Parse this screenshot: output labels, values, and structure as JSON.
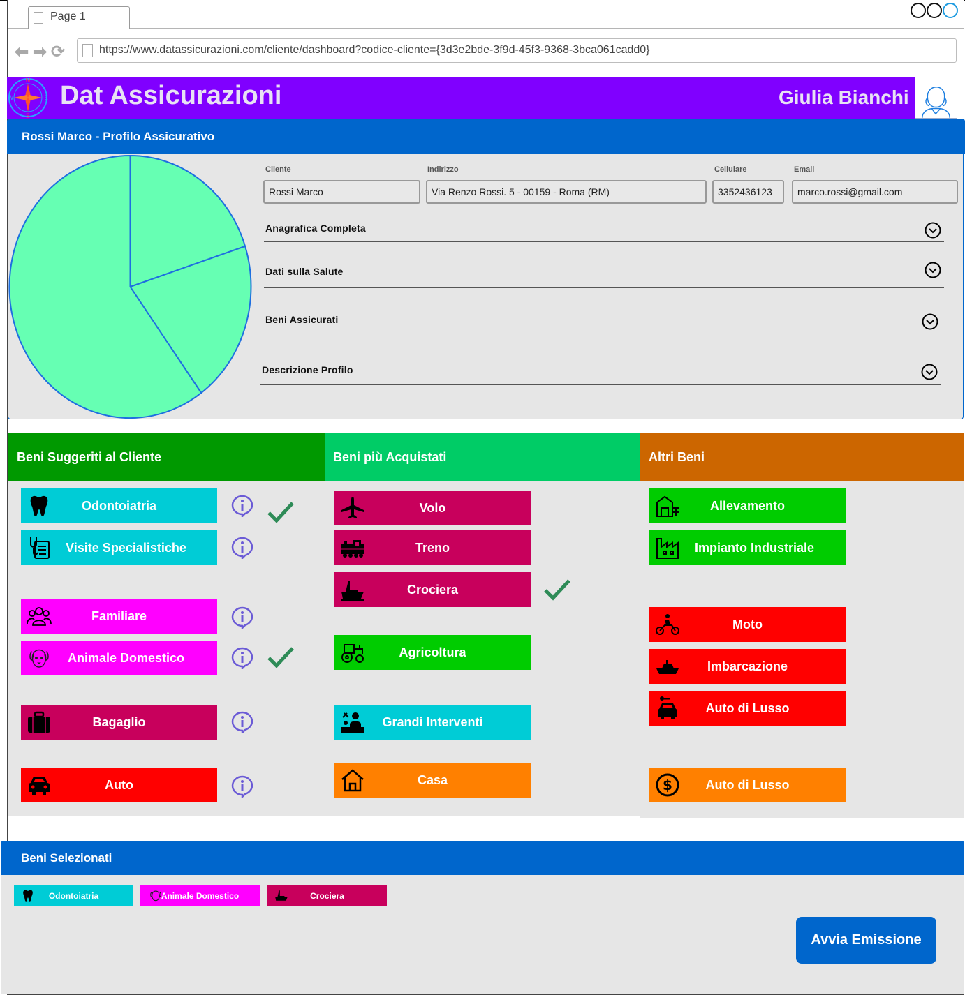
{
  "browser": {
    "tab_label": "Page 1",
    "url": "https://www.datassicurazioni.com/cliente/dashboard?codice-cliente={3d3e2bde-3f9d-45f3-9368-3bca061cadd0}"
  },
  "header": {
    "brand": "Dat Assicurazioni",
    "user_name": "Giulia Bianchi"
  },
  "profile": {
    "title": "Rossi Marco - Profilo Assicurativo",
    "fields": {
      "cliente": {
        "label": "Cliente",
        "value": "Rossi Marco"
      },
      "indirizzo": {
        "label": "Indirizzo",
        "value": "Via Renzo Rossi. 5 - 00159 - Roma (RM)"
      },
      "cellulare": {
        "label": "Cellulare",
        "value": "3352436123"
      },
      "email": {
        "label": "Email",
        "value": "marco.rossi@gmail.com"
      }
    },
    "accordions": [
      {
        "label": "Anagrafica Completa"
      },
      {
        "label": "Dati sulla Salute"
      },
      {
        "label": "Beni Assicurati"
      },
      {
        "label": "Descrizione Profilo"
      }
    ],
    "pie_colors": {
      "fill": "#66ffb3",
      "stroke": "#1e6fe0"
    }
  },
  "chart_data": {
    "type": "pie",
    "values": [
      20,
      20,
      60
    ],
    "labels": [],
    "title": ""
  },
  "columns": {
    "suggested": {
      "title": "Beni Suggeriti al Cliente",
      "color": "#009900",
      "items": [
        {
          "label": "Odontoiatria",
          "icon": "tooth-icon",
          "color": "#00ccd6",
          "selected": true
        },
        {
          "label": "Visite Specialistiche",
          "icon": "medical-record-icon",
          "color": "#00ccd6",
          "selected": false
        },
        {
          "label": "Familiare",
          "icon": "family-icon",
          "color": "#ff00ff",
          "selected": false
        },
        {
          "label": "Animale Domestico",
          "icon": "dog-icon",
          "color": "#ff00ff",
          "selected": true
        },
        {
          "label": "Bagaglio",
          "icon": "luggage-icon",
          "color": "#c8005c",
          "selected": false
        },
        {
          "label": "Auto",
          "icon": "car-icon",
          "color": "#ff0000",
          "selected": false
        }
      ]
    },
    "popular": {
      "title": "Beni più Acquistati",
      "color": "#00cc66",
      "items": [
        {
          "label": "Volo",
          "icon": "airplane-icon",
          "color": "#c8005c",
          "selected": false
        },
        {
          "label": "Treno",
          "icon": "train-icon",
          "color": "#c8005c",
          "selected": false
        },
        {
          "label": "Crociera",
          "icon": "ship-icon",
          "color": "#c8005c",
          "selected": true
        },
        {
          "label": "Agricoltura",
          "icon": "tractor-icon",
          "color": "#00cc00",
          "selected": false
        },
        {
          "label": "Grandi Interventi",
          "icon": "surgery-icon",
          "color": "#00ccd6",
          "selected": false
        },
        {
          "label": "Casa",
          "icon": "house-icon",
          "color": "#ff8000",
          "selected": false
        }
      ]
    },
    "other": {
      "title": "Altri Beni",
      "color": "#cc6600",
      "items": [
        {
          "label": "Allevamento",
          "icon": "barn-icon",
          "color": "#00cc00"
        },
        {
          "label": "Impianto Industriale",
          "icon": "factory-icon",
          "color": "#00cc00"
        },
        {
          "label": "Moto",
          "icon": "motorbike-icon",
          "color": "#ff0000"
        },
        {
          "label": "Imbarcazione",
          "icon": "boat-icon",
          "color": "#ff0000"
        },
        {
          "label": "Auto di Lusso",
          "icon": "luxury-car-icon",
          "color": "#ff0000"
        },
        {
          "label": "Auto di Lusso",
          "icon": "dollar-icon",
          "color": "#ff8000"
        }
      ]
    }
  },
  "selected": {
    "title": "Beni Selezionati",
    "chips": [
      {
        "label": "Odontoiatria",
        "icon": "tooth-icon",
        "color": "#00ccd6"
      },
      {
        "label": "Animale Domestico",
        "icon": "dog-icon",
        "color": "#ff00ff"
      },
      {
        "label": "Crociera",
        "icon": "ship-icon",
        "color": "#c8005c"
      }
    ],
    "action_label": "Avvia Emissione"
  },
  "colors": {
    "primary": "#0066cc",
    "brand_purple": "#8000ff",
    "check_green": "#2e8b57",
    "info_purple": "#6b5bd6"
  }
}
